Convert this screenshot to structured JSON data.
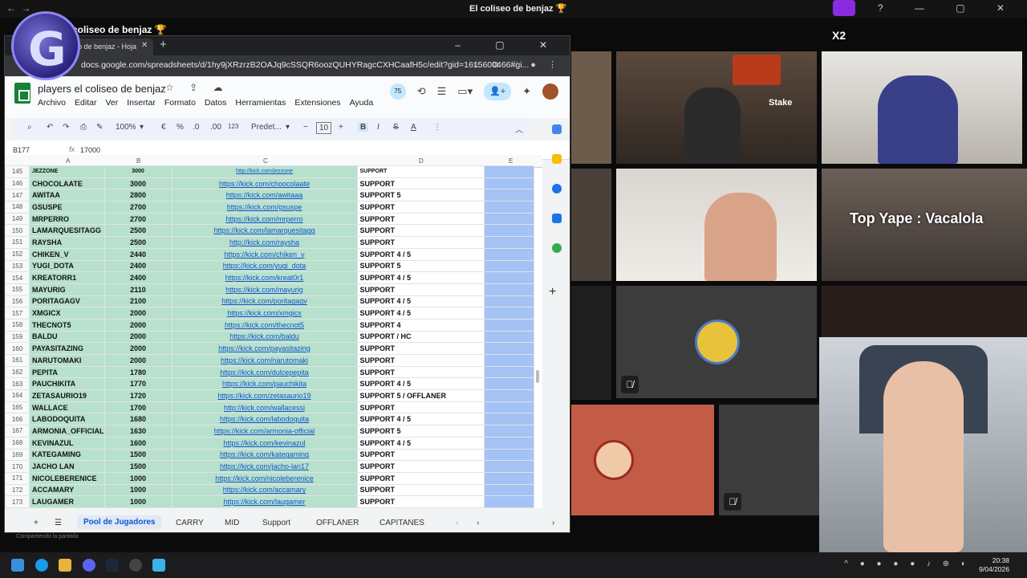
{
  "window": {
    "title": "El coliseo de benjaz 🏆",
    "stream_title": "coliseo de benjaz 🏆",
    "logo_letter": "G",
    "sharing_text": "Compartiendo la pantalla"
  },
  "browser": {
    "tab_title": "o de benjaz - Hoja",
    "url": "docs.google.com/spreadsheets/d/1hy9jXRzrzB2OAJq9cSSQR6oozQUHYRagcCXHCaafH5c/edit?gid=1615600466#gi..."
  },
  "sheet": {
    "title": "players el coliseo de benjaz",
    "menu": [
      "Archivo",
      "Editar",
      "Ver",
      "Insertar",
      "Formato",
      "Datos",
      "Herramientas",
      "Extensiones",
      "Ayuda"
    ],
    "badge_count": "75",
    "toolbar": {
      "zoom": "100%",
      "currency": "€",
      "percent": "%",
      "dec_less": ".0",
      "dec_more": ".00",
      "format_123": "123",
      "font": "Predet...",
      "font_size": "10",
      "bold": "B",
      "italic": "I",
      "strike": "S",
      "text_color": "A"
    },
    "cell_ref": "B177",
    "formula_value": "17000",
    "column_headers": [
      "A",
      "B",
      "C",
      "D",
      "E"
    ],
    "partial_row": {
      "num": "145",
      "name": "JEZZONE",
      "mmr": "3000",
      "link": "http://kick.com/jezzone",
      "pos": "SUPPORT"
    },
    "rows": [
      {
        "num": "146",
        "name": "CHOCOLAATE",
        "mmr": "3000",
        "link": "https://kick.com/choocolaate",
        "pos": "SUPPORT"
      },
      {
        "num": "147",
        "name": "AWITAA",
        "mmr": "2800",
        "link": "https://kick.com/awitaaa",
        "pos": "SUPPORT 5"
      },
      {
        "num": "148",
        "name": "GSUSPE",
        "mmr": "2700",
        "link": "https://kick.com/gsuspe",
        "pos": "SUPPORT"
      },
      {
        "num": "149",
        "name": "MRPERRO",
        "mmr": "2700",
        "link": "https://kick.com/mrperro",
        "pos": "SUPPORT"
      },
      {
        "num": "150",
        "name": "LAMARQUESITAGG",
        "mmr": "2500",
        "link": "https://kick.com/lamarquesitagg",
        "pos": "SUPPORT"
      },
      {
        "num": "151",
        "name": "RAYSHA",
        "mmr": "2500",
        "link": "http://kick.com/raysha",
        "pos": "SUPPORT"
      },
      {
        "num": "152",
        "name": "CHIKEN_V",
        "mmr": "2440",
        "link": "https://kick.com/chiken_v",
        "pos": "SUPPORT 4 / 5"
      },
      {
        "num": "153",
        "name": "YUGI_DOTA",
        "mmr": "2400",
        "link": "https://kick.com/yugi_dota",
        "pos": "SUPPORT 5"
      },
      {
        "num": "154",
        "name": "KREATORR1",
        "mmr": "2400",
        "link": "https://kick.com/kreat0r1",
        "pos": "SUPPORT 4 / 5"
      },
      {
        "num": "155",
        "name": "MAYURIG",
        "mmr": "2110",
        "link": "https://kick.com/mayurig",
        "pos": "SUPPORT"
      },
      {
        "num": "156",
        "name": "PORITAGAGV",
        "mmr": "2100",
        "link": "https://kick.com/poritagagv",
        "pos": "SUPPORT 4 / 5"
      },
      {
        "num": "157",
        "name": "XMGICX",
        "mmr": "2000",
        "link": "https://kick.com/xmgicx",
        "pos": "SUPPORT 4 / 5"
      },
      {
        "num": "158",
        "name": "THECNOT5",
        "mmr": "2000",
        "link": "https://kick.com/thecnot5",
        "pos": "SUPPORT 4"
      },
      {
        "num": "159",
        "name": "BALDU",
        "mmr": "2000",
        "link": "https://kick.com/baldu",
        "pos": "SUPPORT / HC"
      },
      {
        "num": "160",
        "name": "PAYASITAZING",
        "mmr": "2000",
        "link": "https://kick.com/payasitazing",
        "pos": "SUPPORT"
      },
      {
        "num": "161",
        "name": "NARUTOMAKI",
        "mmr": "2000",
        "link": "https://kick.com/narutomaki",
        "pos": "SUPPORT"
      },
      {
        "num": "162",
        "name": "PEPITA",
        "mmr": "1780",
        "link": "https://kick.com/dulcepepita",
        "pos": "SUPPORT"
      },
      {
        "num": "163",
        "name": "PAUCHIKITA",
        "mmr": "1770",
        "link": "https://kick.com/pauchikita",
        "pos": "SUPPORT 4 / 5"
      },
      {
        "num": "164",
        "name": "ZETASAURIO19",
        "mmr": "1720",
        "link": "https://kick.com/zetasaurio19",
        "pos": "SUPPORT 5 / OFFLANER"
      },
      {
        "num": "165",
        "name": "WALLACE",
        "mmr": "1700",
        "link": "http://kick.com/wallacessj",
        "pos": "SUPPORT"
      },
      {
        "num": "166",
        "name": "LABODOQUITA",
        "mmr": "1680",
        "link": "https://kick.com/labodoquita",
        "pos": "SUPPORT 4 / 5"
      },
      {
        "num": "167",
        "name": "ARMONIA_OFFICIAL",
        "mmr": "1630",
        "link": "https://kick.com/armonia-official",
        "pos": "SUPPORT 5"
      },
      {
        "num": "168",
        "name": "KEVINAZUL",
        "mmr": "1600",
        "link": "https://kick.com/kevinazul",
        "pos": "SUPPORT 4 / 5"
      },
      {
        "num": "169",
        "name": "KATEGAMING",
        "mmr": "1500",
        "link": "https://kick.com/kategaming",
        "pos": "SUPPORT"
      },
      {
        "num": "170",
        "name": "JACHO LAN",
        "mmr": "1500",
        "link": "https://kick.com/jacho-lan17",
        "pos": "SUPPORT"
      },
      {
        "num": "171",
        "name": "NICOLEBERENICE",
        "mmr": "1000",
        "link": "https://kick.com/nicoleberenice",
        "pos": "SUPPORT"
      },
      {
        "num": "172",
        "name": "ACCAMARY",
        "mmr": "1000",
        "link": "https://kick.com/accamary",
        "pos": "SUPPORT"
      },
      {
        "num": "173",
        "name": "LAUGAMER",
        "mmr": "1000",
        "link": "https://kick.com/laugamer",
        "pos": "SUPPORT"
      }
    ],
    "tabs": [
      "Pool de Jugadores",
      "CARRY",
      "MID",
      "Support",
      "OFFLANER",
      "CAPITANES"
    ]
  },
  "overlay": {
    "badge_text": "X2",
    "cam_label": "Top Yape : Vacalola",
    "cam_sign": "Stake"
  },
  "taskbar": {
    "time": "20:38",
    "date": "9/04/2026"
  }
}
